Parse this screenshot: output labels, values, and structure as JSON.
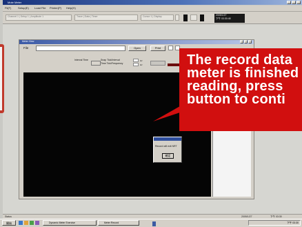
{
  "app": {
    "title": "Mote Meter",
    "menu": [
      "Fil(F)",
      "Setup(E)",
      "Load File",
      "Printer(P)",
      "Help(H)"
    ],
    "toolbar_fields": [
      "Channel 1  |  Setup 1  |  Amplitude 1",
      "Trace  |  Data  |  Timer",
      "Cursor 1  |  Display"
    ],
    "datetime_line1": "2005/1/27",
    "datetime_line2": "下午 03:30:48"
  },
  "doc_window": {
    "title": "Meter View",
    "file_label": "File",
    "file_value": "",
    "open_label": "Open",
    "print_label": "Print",
    "interval_label": "Interval Time",
    "snap_label_1": "Snap Tick/Interval",
    "snap_label_2": "Time Tick/Frequency",
    "unit_1": "Hz",
    "unit_2": "Hz"
  },
  "dialog": {
    "message": "Record will exit NRT",
    "ok_label": "確定"
  },
  "status": {
    "left": "Status",
    "right_date": "2005/1/27",
    "right_time": "下午 03:30"
  },
  "taskbar": {
    "start_label": "開始",
    "tasks": [
      "Dynamic Meter Exercise",
      "Meter Record"
    ],
    "tray_time": "下午 03:30"
  },
  "callout": {
    "text": "The record data\nmeter is finished\nreading, press\nbutton to conti",
    "color": "#d10f0f"
  }
}
